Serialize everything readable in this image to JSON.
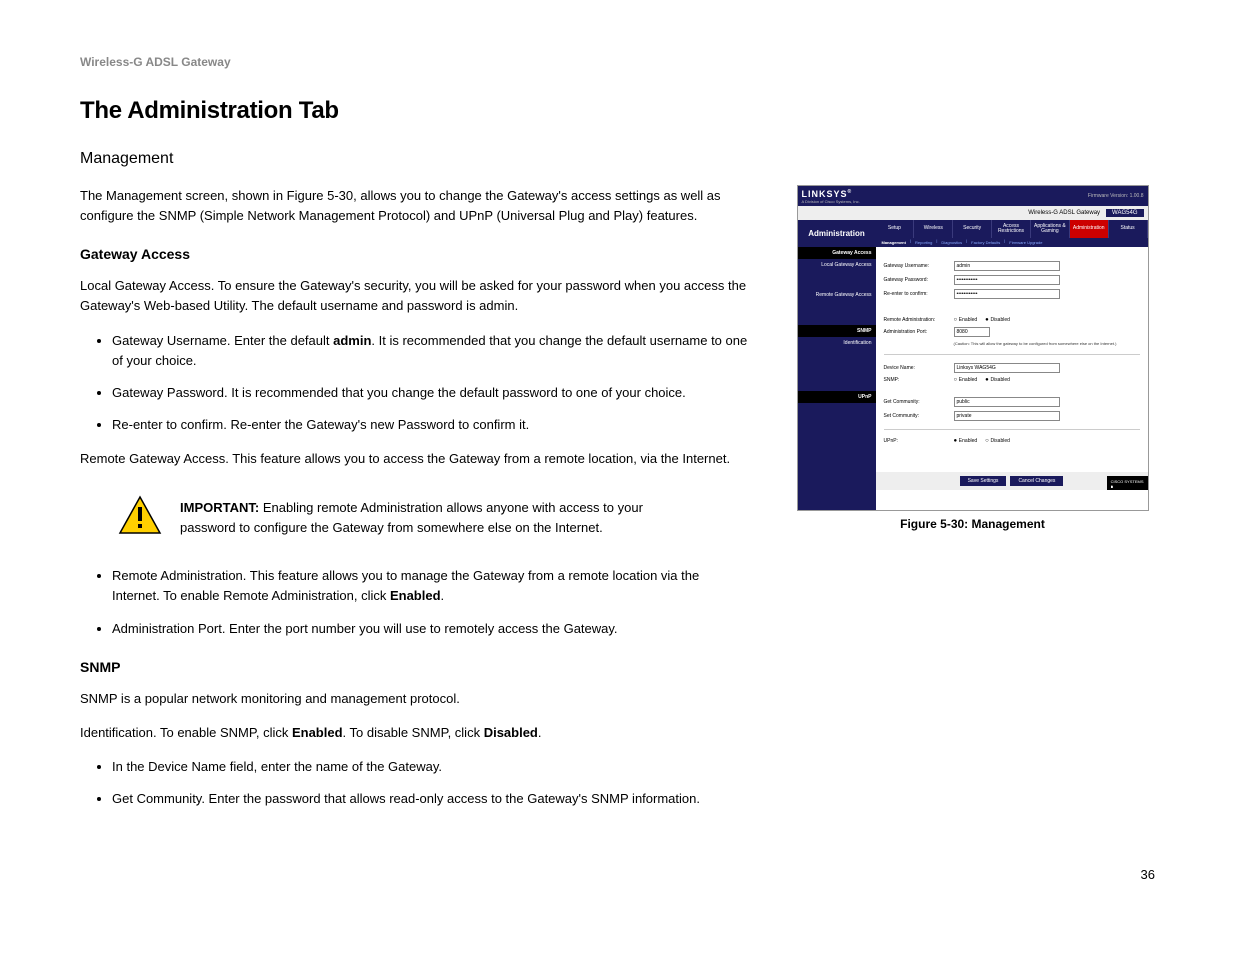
{
  "header": "Wireless-G ADSL Gateway",
  "title": "The Administration Tab",
  "h2": "Management",
  "intro": "The Management screen, shown in Figure 5-30, allows you to change the Gateway's access settings as well as configure the SNMP (Simple Network Management Protocol) and UPnP (Universal Plug and Play) features.",
  "gateway": {
    "heading": "Gateway Access",
    "p1": "Local Gateway Access. To ensure the Gateway's security, you will be asked for your password when you access the Gateway's Web-based Utility. The default username and password is admin.",
    "li1a": "Gateway Username. Enter the default ",
    "li1b": "admin",
    "li1c": ". It is recommended that you change the default username to one of your choice.",
    "li2": "Gateway Password. It is recommended that you change the default password to one of your choice.",
    "li3": "Re-enter to confirm. Re-enter the Gateway's new Password to confirm it.",
    "p2": "Remote Gateway Access. This feature allows you to access the Gateway from a remote location, via the Internet."
  },
  "important": {
    "label": "IMPORTANT:",
    "text": " Enabling remote Administration allows anyone with access to your password to configure the Gateway from somewhere else on the Internet."
  },
  "remote": {
    "li1a": "Remote Administration. This feature allows you to manage the Gateway from a remote location via the Internet. To enable Remote Administration, click ",
    "li1b": "Enabled",
    "li1c": ".",
    "li2": "Administration Port. Enter the port number you will use to remotely access the Gateway."
  },
  "snmp": {
    "heading": "SNMP",
    "p1": "SNMP is a popular network monitoring and management protocol.",
    "p2a": "Identification. To enable SNMP, click ",
    "p2b": "Enabled",
    "p2c": ". To disable SNMP, click ",
    "p2d": "Disabled",
    "p2e": ".",
    "li1": "In the Device Name field, enter the name of the Gateway.",
    "li2": "Get Community. Enter the password that allows read-only access to the Gateway's SNMP information."
  },
  "pageNum": "36",
  "figure": {
    "caption": "Figure 5-30: Management",
    "logo": "LINKSYS",
    "sublogo": "A Division of Cisco Systems, Inc.",
    "fw": "Firmware Version: 1.00.8",
    "productTitle": "Wireless-G ADSL Gateway",
    "model": "WAG54G",
    "sideTitle": "Administration",
    "tabs": [
      "Setup",
      "Wireless",
      "Security",
      "Access Restrictions",
      "Applications & Gaming",
      "Administration",
      "Status"
    ],
    "subtabs": [
      "Management",
      "Reporting",
      "Diagnostics",
      "Factory Defaults",
      "Firmware Upgrade"
    ],
    "sections": {
      "gw": "Gateway Access",
      "local": "Local Gateway Access",
      "remote": "Remote Gateway Access",
      "snmp": "SNMP",
      "ident": "Identification",
      "upnp": "UPnP"
    },
    "labels": {
      "username": "Gateway Username:",
      "password": "Gateway Password:",
      "reenter": "Re-enter to confirm:",
      "remoteAdmin": "Remote Administration:",
      "adminPort": "Administration Port:",
      "deviceName": "Device Name:",
      "snmp": "SNMP:",
      "getComm": "Get Community:",
      "setComm": "Set Community:",
      "upnp": "UPnP:"
    },
    "values": {
      "username": "admin",
      "password": "••••••••••••",
      "reenter": "••••••••••••",
      "adminPort": "8080",
      "deviceName": "Linksys WAG54G",
      "getComm": "public",
      "setComm": "private"
    },
    "radio": {
      "enabled": "Enabled",
      "disabled": "Disabled"
    },
    "caution": "(Caution: This will allow the gateway to be configured from somewhere else on the Internet.)",
    "buttons": {
      "save": "Save Settings",
      "cancel": "Cancel Changes"
    },
    "cisco": "CISCO SYSTEMS"
  }
}
